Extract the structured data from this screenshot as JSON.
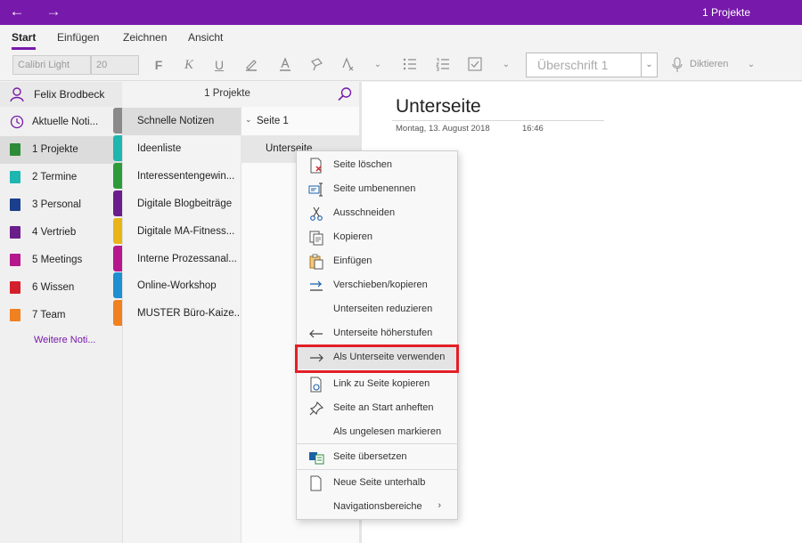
{
  "window": {
    "title": "1 Projekte",
    "back_icon": "arrow-left-icon",
    "forward_icon": "arrow-right-icon"
  },
  "ribbon": {
    "tabs": [
      "Start",
      "Einfügen",
      "Zeichnen",
      "Ansicht"
    ],
    "active_tab": "Start",
    "font_name": "Calibri Light",
    "font_size": "20",
    "bold": "F",
    "italic": "K",
    "underline": "U",
    "style": "Überschrift 1",
    "dictate": "Diktieren"
  },
  "sidebar": {
    "user": "Felix Brodbeck",
    "recent": "Aktuelle Noti...",
    "notebooks": [
      {
        "label": "1 Projekte",
        "color": "#2e8b3a"
      },
      {
        "label": "2 Termine",
        "color": "#1db6b0"
      },
      {
        "label": "3 Personal",
        "color": "#1a3f8c"
      },
      {
        "label": "4 Vertrieb",
        "color": "#6a1e8c"
      },
      {
        "label": "5 Meetings",
        "color": "#b5178c"
      },
      {
        "label": "6 Wissen",
        "color": "#d4202c"
      },
      {
        "label": "7 Team",
        "color": "#f08020"
      }
    ],
    "more": "Weitere Noti..."
  },
  "sections": {
    "header": "1 Projekte",
    "items": [
      {
        "label": "Schnelle Notizen",
        "color": "#8a8a8a"
      },
      {
        "label": "Ideenliste",
        "color": "#1db6b0"
      },
      {
        "label": "Interessentengewin...",
        "color": "#2e9b3a"
      },
      {
        "label": "Digitale Blogbeiträge",
        "color": "#6a1e8c"
      },
      {
        "label": "Digitale MA-Fitness...",
        "color": "#e8b416"
      },
      {
        "label": "Interne Prozessanal...",
        "color": "#b5178c"
      },
      {
        "label": "Online-Workshop",
        "color": "#1e8fd0"
      },
      {
        "label": "MUSTER Büro-Kaize...",
        "color": "#f08020"
      }
    ]
  },
  "pages": {
    "items": [
      "Seite 1",
      "Unterseite"
    ]
  },
  "canvas": {
    "title": "Unterseite",
    "date": "Montag, 13. August 2018",
    "time": "16:46"
  },
  "context_menu": {
    "items": [
      "Seite löschen",
      "Seite umbenennen",
      "Ausschneiden",
      "Kopieren",
      "Einfügen",
      "Verschieben/kopieren",
      "Unterseiten reduzieren",
      "Unterseite höherstufen",
      "Als Unterseite verwenden",
      "Link zu Seite kopieren",
      "Seite an Start anheften",
      "Als ungelesen markieren",
      "Seite übersetzen",
      "Neue Seite unterhalb",
      "Navigationsbereiche"
    ],
    "highlighted": "Als Unterseite verwenden"
  }
}
